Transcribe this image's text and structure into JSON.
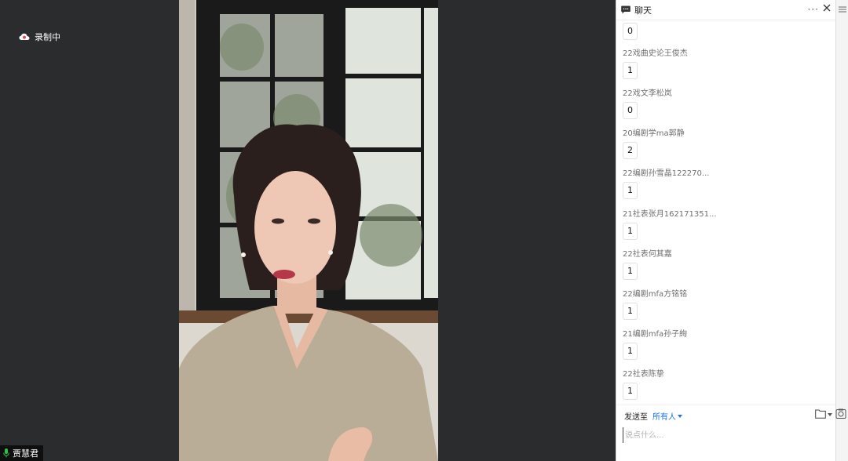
{
  "recording": {
    "label": "录制中",
    "icon": "cloud-record-icon",
    "accent": "#e24b4b"
  },
  "participant": {
    "name": "贾慧君",
    "icon": "mic-icon",
    "mic_color": "#2fbf4a"
  },
  "chat": {
    "title": "聊天",
    "more_label": "···",
    "messages": [
      {
        "sender": "",
        "text": "0"
      },
      {
        "sender": "22戏曲史论王俊杰",
        "text": "1"
      },
      {
        "sender": "22戏文李松岚",
        "text": "0"
      },
      {
        "sender": "20编剧学ma郭静",
        "text": "2"
      },
      {
        "sender": "22编剧孙雪晶122270...",
        "text": "1"
      },
      {
        "sender": "21社表张月162171351...",
        "text": "1"
      },
      {
        "sender": "22社表何其嘉",
        "text": "1"
      },
      {
        "sender": "22编剧mfa方铭铭",
        "text": "1"
      },
      {
        "sender": "21编剧mfa孙子絢",
        "text": "1"
      },
      {
        "sender": "22社表陈挚",
        "text": "1"
      }
    ],
    "send_to_label": "发送至",
    "recipient": "所有人",
    "input_placeholder": "说点什么...",
    "recipient_color": "#1a73e8"
  }
}
